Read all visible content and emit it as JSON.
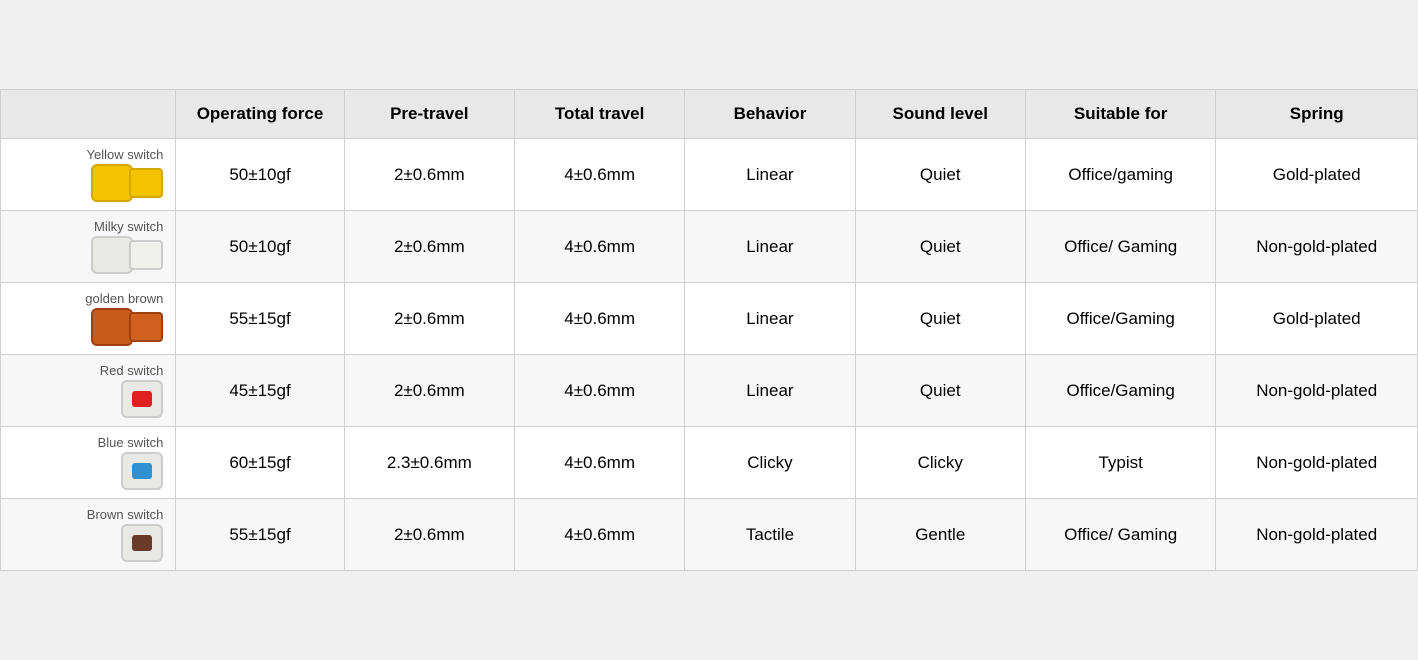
{
  "header": {
    "col_switch": "",
    "col_opforce": "Operating force",
    "col_pretravel": "Pre-travel",
    "col_totaltravel": "Total travel",
    "col_behavior": "Behavior",
    "col_sound": "Sound level",
    "col_suitable": "Suitable for",
    "col_spring": "Spring"
  },
  "rows": [
    {
      "switch_name": "Yellow switch",
      "switch_type": "yellow",
      "op_force": "50±10gf",
      "pre_travel": "2±0.6mm",
      "total_travel": "4±0.6mm",
      "behavior": "Linear",
      "sound": "Quiet",
      "suitable": "Office/gaming",
      "spring": "Gold-plated"
    },
    {
      "switch_name": "Milky switch",
      "switch_type": "milky",
      "op_force": "50±10gf",
      "pre_travel": "2±0.6mm",
      "total_travel": "4±0.6mm",
      "behavior": "Linear",
      "sound": "Quiet",
      "suitable": "Office/ Gaming",
      "spring": "Non-gold-plated"
    },
    {
      "switch_name": "golden brown",
      "switch_type": "golden",
      "op_force": "55±15gf",
      "pre_travel": "2±0.6mm",
      "total_travel": "4±0.6mm",
      "behavior": "Linear",
      "sound": "Quiet",
      "suitable": "Office/Gaming",
      "spring": "Gold-plated"
    },
    {
      "switch_name": "Red switch",
      "switch_type": "red",
      "op_force": "45±15gf",
      "pre_travel": "2±0.6mm",
      "total_travel": "4±0.6mm",
      "behavior": "Linear",
      "sound": "Quiet",
      "suitable": "Office/Gaming",
      "spring": "Non-gold-plated"
    },
    {
      "switch_name": "Blue switch",
      "switch_type": "blue",
      "op_force": "60±15gf",
      "pre_travel": "2.3±0.6mm",
      "total_travel": "4±0.6mm",
      "behavior": "Clicky",
      "sound": "Clicky",
      "suitable": "Typist",
      "spring": "Non-gold-plated"
    },
    {
      "switch_name": "Brown switch",
      "switch_type": "brown",
      "op_force": "55±15gf",
      "pre_travel": "2±0.6mm",
      "total_travel": "4±0.6mm",
      "behavior": "Tactile",
      "sound": "Gentle",
      "suitable": "Office/ Gaming",
      "spring": "Non-gold-plated"
    }
  ]
}
